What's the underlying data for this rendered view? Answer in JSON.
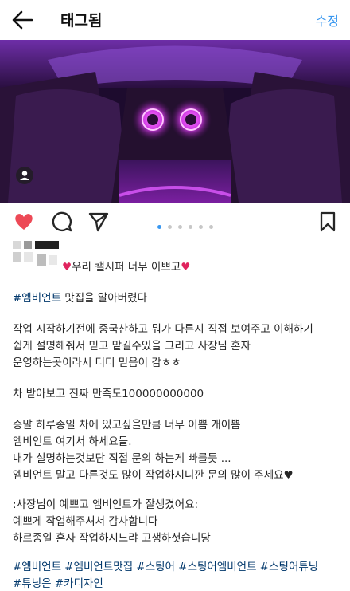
{
  "header": {
    "back_icon": "arrow-left-icon",
    "title": "태그됨",
    "edit_label": "수정"
  },
  "post": {
    "photo_desc_icon": "car-interior-purple-ambient-light-photo",
    "tag_icon": "person-tag-icon",
    "carousel": {
      "count": 6,
      "active_index": 0
    }
  },
  "actions": {
    "like_icon": "heart-filled-icon",
    "comment_icon": "comment-icon",
    "share_icon": "paper-plane-icon",
    "save_icon": "bookmark-icon"
  },
  "caption": {
    "first_line": "우리 캘시퍼 너무 이쁘고",
    "line_hashtag": "#엠비언트",
    "line_hashtag_suffix": " 맛집을 알아버렸다",
    "para1_1": "작업 시작하기전에 중국산하고 뭐가 다른지 직접 보여주고 이해하기",
    "para1_2": "쉽게 설명해줘서 믿고 맡길수있을 그리고 사장님 혼자",
    "para1_3": "운영하는곳이라서 더더 믿음이 감ㅎㅎ",
    "para2": "차 받아보고 진짜 만족도100000000000",
    "para3_1": "증말 하루종일 차에 있고싶을만큼 너무 이쁨 개이쁨",
    "para3_2": "엠비언트 여기서 하세요들.",
    "para3_3": "내가 설명하는것보단 직접 문의 하는게 빠를듯 ...",
    "para3_4": "엠비언트 말고 다른것도 많이 작업하시니깐 문의 많이 주세요",
    "para4_1": ":사장님이 예쁘고 엠비언트가 잘생겼어요:",
    "para4_2": "예쁘게 작업해주셔서 감사합니다",
    "para4_3": "하르종일 혼자 작업하시느랴 고생하셧습니당",
    "tags_line1": "#엠비언트 #엠비언트맛집 #스팅어 #스팅어엠비언트 #스팅어튜닝",
    "tags_line2": "#튜닝은 #카디자인"
  },
  "colors": {
    "accent": "#3897f0",
    "like": "#ed4956",
    "hashtag": "#00376b",
    "ambient": "#c42bd6"
  }
}
